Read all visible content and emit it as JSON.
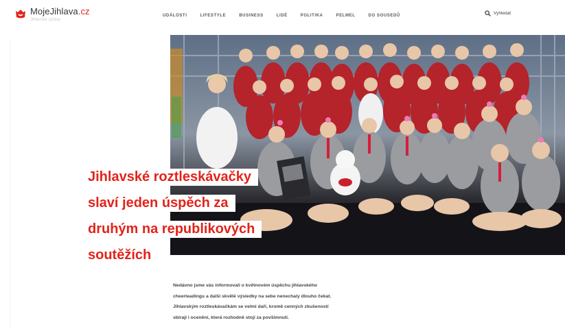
{
  "header": {
    "logo_name": "MojeJihlava",
    "logo_tld": ".cz",
    "logo_tagline": "Jihlavské zprávy",
    "nav": [
      "UDÁLOSTI",
      "LIFESTYLE",
      "BUSINESS",
      "LIDÉ",
      "POLITIKA",
      "PELMEL",
      "DO SOUSEDŮ"
    ],
    "search_label": "Vyhledat"
  },
  "hero": {
    "headline_lines": [
      "Jihlavské roztleskávačky",
      "slaví jeden úspěch za",
      "druhým na republikových",
      "soutěžích"
    ],
    "photo": "group-photo-of-cheerleaders"
  },
  "article": {
    "intro_lines": [
      "Nedávno jsme vás informovali o květnovém úspěchu jihlavského",
      "cheerleadingu a další skvělé výsledky na sebe nenechaly dlouho čekat.",
      "Jihlavským roztleskávačkám se velmi daří, kromě cenných zkušeností",
      "sbírají i ocenění, která rozhodně stojí za povšimnutí."
    ]
  },
  "colors": {
    "brand": "#e2231a",
    "text": "#444444"
  }
}
